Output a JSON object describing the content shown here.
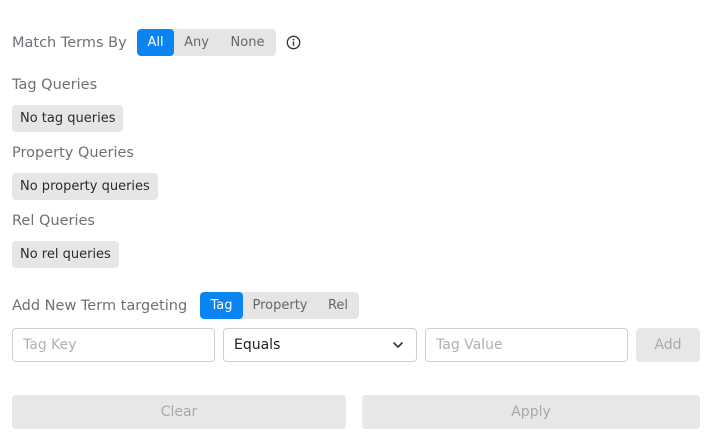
{
  "match": {
    "label": "Match Terms By",
    "options": [
      "All",
      "Any",
      "None"
    ],
    "selected": "All",
    "info_icon": "info-circle-icon"
  },
  "tag_queries": {
    "label": "Tag Queries",
    "empty": "No tag queries"
  },
  "property_queries": {
    "label": "Property Queries",
    "empty": "No property queries"
  },
  "rel_queries": {
    "label": "Rel Queries",
    "empty": "No rel queries"
  },
  "add_term": {
    "label": "Add New Term targeting",
    "targets": [
      "Tag",
      "Property",
      "Rel"
    ],
    "selected": "Tag",
    "key_placeholder": "Tag Key",
    "operator": "Equals",
    "value_placeholder": "Tag Value",
    "add_label": "Add",
    "dropdown_icon": "chevron-down-icon"
  },
  "footer": {
    "clear_label": "Clear",
    "apply_label": "Apply"
  },
  "colors": {
    "accent": "#0a84f0",
    "segment_bg": "#e5e5e5",
    "disabled_bg": "#e7e7e7"
  }
}
